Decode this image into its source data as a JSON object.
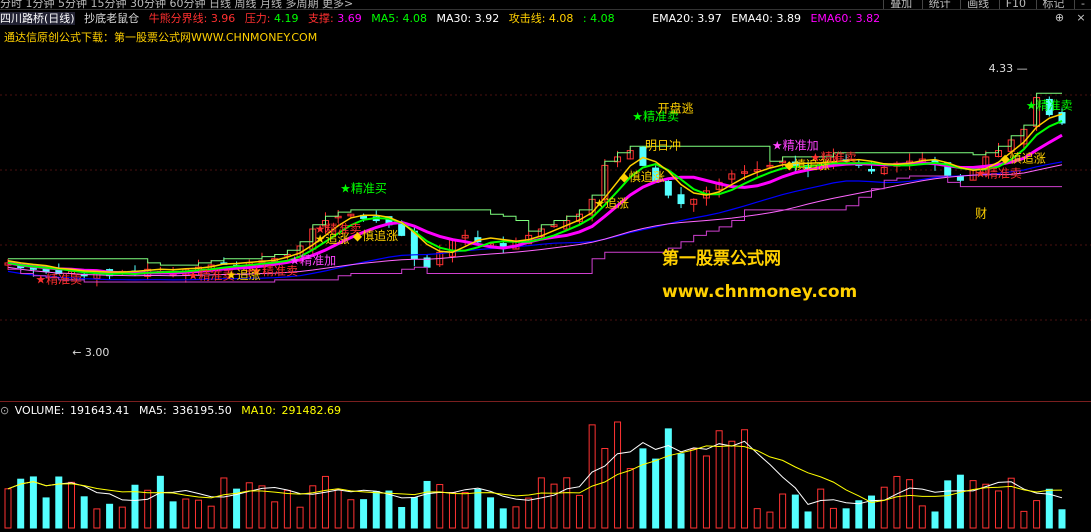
{
  "window": {
    "period_tabs": "分时  1分钟  5分钟  15分钟  30分钟  60分钟  日线  周线  月线  多周期  更多>",
    "right_buttons": [
      "叠加",
      "统计",
      "画线",
      "F10",
      "标记",
      "-"
    ],
    "win_buttons": [
      "⊕",
      "×"
    ]
  },
  "info": {
    "stock": "四川路桥(日线)",
    "indicator": "抄底老鼠仓",
    "bull_line_label": "牛熊分界线:",
    "bull_line_value": "3.96",
    "pressure_label": "压力:",
    "pressure_value": "4.19",
    "support_label": "支撑:",
    "support_value": "3.69",
    "ma5_label": "MA5:",
    "ma5_value": "4.08",
    "ma30_label": "MA30:",
    "ma30_value": "3.92",
    "attack_label": "攻击线:",
    "attack_value": "4.08",
    "attack_extra": ": 4.08",
    "ema20_label": "EMA20:",
    "ema20_value": "3.97",
    "ema40_label": "EMA40:",
    "ema40_value": "3.89",
    "ema60_label": "EMA60:",
    "ema60_value": "3.82"
  },
  "ad_text": "通达信原创公式下载：第一股票公式网WWW.CHNMONEY.COM",
  "watermark_cn": "第一股票公式网",
  "watermark_url": "www.chnmoney.com",
  "volume": {
    "vol_label": "VOLUME:",
    "vol_value": "191643.41",
    "ma5_label": "MA5:",
    "ma5_value": "336195.50",
    "ma10_label": "MA10:",
    "ma10_value": "291482.69"
  },
  "colors": {
    "up": "#ff3232",
    "down": "#54ffff",
    "ma5": "#ffffff",
    "ma10": "#ffff00",
    "attack": "#ff00ff",
    "ema": "#0000ff",
    "signal": "#00ff00"
  },
  "chart_data": {
    "type": "candlestick",
    "title": "四川路桥(日线)",
    "price_range": [
      3.0,
      4.33
    ],
    "high_label": "4.33",
    "low_label": "3.00",
    "annotations": [
      {
        "text": "★精准卖",
        "kind": "sell"
      },
      {
        "text": "★精准卖",
        "kind": "sell"
      },
      {
        "text": "★精准卖",
        "kind": "sell"
      },
      {
        "text": "★精准卖",
        "kind": "sell"
      },
      {
        "text": "★精准卖",
        "kind": "sell"
      },
      {
        "text": "★精准卖",
        "kind": "sell"
      },
      {
        "text": "★精准卖",
        "kind": "sell"
      },
      {
        "text": "★精准卖",
        "kind": "sell"
      },
      {
        "text": "★精准买",
        "kind": "buy"
      },
      {
        "text": "★追涨",
        "kind": "chase"
      },
      {
        "text": "★追涨",
        "kind": "chase"
      },
      {
        "text": "★追涨",
        "kind": "chase"
      },
      {
        "text": "◆慎追涨",
        "kind": "caution"
      },
      {
        "text": "◆慎追涨",
        "kind": "caution"
      },
      {
        "text": "◆慎追涨",
        "kind": "caution"
      },
      {
        "text": "◆慎追涨",
        "kind": "caution"
      },
      {
        "text": "★精准加",
        "kind": "add"
      },
      {
        "text": "★精准加",
        "kind": "add"
      },
      {
        "text": "明日冲",
        "kind": "note"
      },
      {
        "text": "开盘逃",
        "kind": "note"
      },
      {
        "text": "财",
        "kind": "note"
      }
    ],
    "close": [
      3.42,
      3.4,
      3.39,
      3.38,
      3.37,
      3.38,
      3.36,
      3.37,
      3.36,
      3.38,
      3.37,
      3.39,
      3.38,
      3.37,
      3.39,
      3.4,
      3.41,
      3.42,
      3.4,
      3.42,
      3.43,
      3.44,
      3.46,
      3.5,
      3.58,
      3.62,
      3.64,
      3.65,
      3.63,
      3.62,
      3.6,
      3.55,
      3.44,
      3.4,
      3.47,
      3.53,
      3.55,
      3.52,
      3.51,
      3.5,
      3.52,
      3.55,
      3.58,
      3.6,
      3.62,
      3.65,
      3.72,
      3.88,
      3.92,
      3.95,
      3.88,
      3.8,
      3.74,
      3.7,
      3.72,
      3.76,
      3.8,
      3.84,
      3.85,
      3.86,
      3.88,
      3.9,
      3.88,
      3.86,
      3.89,
      3.92,
      3.9,
      3.88,
      3.86,
      3.87,
      3.89,
      3.9,
      3.91,
      3.89,
      3.83,
      3.81,
      3.86,
      3.92,
      3.95,
      4.0,
      4.05,
      4.2,
      4.12,
      4.08
    ]
  }
}
